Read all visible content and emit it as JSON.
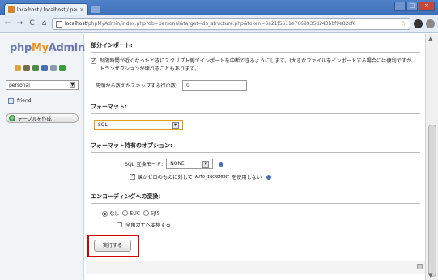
{
  "browser": {
    "tab_title": "localhost / localhost / pers",
    "tab_close": "×",
    "url_host": "localhost",
    "url_rest": "/phpMyAdmin/index.php?db=personal&target=db_structure.php&token=6a21f5611e7669935d243bbf9e82cf6",
    "window_buttons": [
      "–",
      "□",
      "×"
    ],
    "nav": {
      "back": "←",
      "forward": "→",
      "reload": "C",
      "home": "⌂"
    },
    "star": "☆"
  },
  "sidebar": {
    "logo_php": "php",
    "logo_my": "My",
    "logo_admin": "Admin",
    "database_select": "personal",
    "tables": [
      "friend"
    ],
    "create_table_button": "テーブルを作成"
  },
  "partial_import": {
    "title": "部分インポート:",
    "allow_interrupt_checked": true,
    "allow_interrupt_text": "制限時間が近くなったときにスクリプト側でインポートを中断できるようにします。(大きなファイルをインポートする場合には便利ですが、トランザクションが壊れることもあります。)",
    "skip_label": "先頭から数えたスキップする行の数:",
    "skip_value": "0"
  },
  "format": {
    "title": "フォーマット:",
    "selected": "SQL"
  },
  "format_options": {
    "title": "フォーマット特有のオプション:",
    "compat_label": "SQL 互換モード:",
    "compat_value": "NONE",
    "no_auto_zero_checked": true,
    "no_auto_zero_prefix": "値がゼロのものに対して",
    "no_auto_zero_code": "AUTO_INCREMENT",
    "no_auto_zero_suffix": "を使用しない"
  },
  "encoding": {
    "title": "エンコーディングへの変換:",
    "options": [
      "なし",
      "EUC",
      "SJIS"
    ],
    "selected": "なし",
    "kana_checked": false,
    "kana_label": "全角カナへ変換する"
  },
  "actions": {
    "execute_button": "実行する"
  },
  "colors": {
    "highlight": "#d20000",
    "logo_blue": "#6c78af",
    "logo_orange": "#f29111"
  }
}
